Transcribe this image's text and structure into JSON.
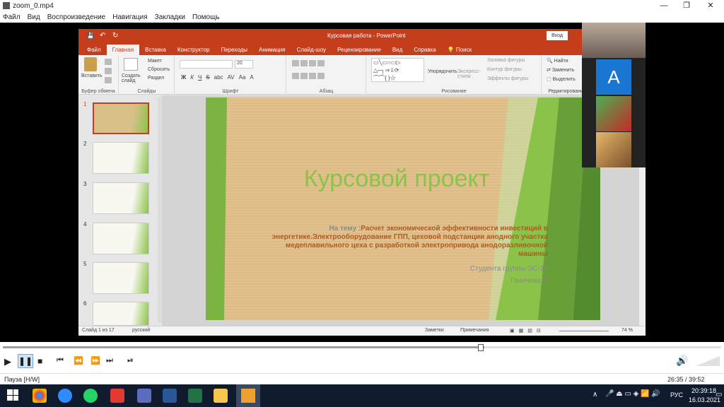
{
  "player": {
    "title": "zoom_0.mp4",
    "menu": [
      "Файл",
      "Вид",
      "Воспроизведение",
      "Навигация",
      "Закладки",
      "Помощь"
    ],
    "status": "Пауза [H/W]",
    "time": "26:35 / 39:52"
  },
  "ppt": {
    "window_title": "Курсовая работа  -  PowerPoint",
    "signin": "Вход",
    "tabs": [
      "Файл",
      "Главная",
      "Вставка",
      "Конструктор",
      "Переходы",
      "Анимация",
      "Слайд-шоу",
      "Рецензирование",
      "Вид",
      "Справка",
      "Поиск"
    ],
    "active_tab": "Главная",
    "groups": {
      "clipboard": {
        "name": "Буфер обмена",
        "paste": "Вставить"
      },
      "slides": {
        "name": "Слайды",
        "create": "Создать слайд",
        "layout": "Макет",
        "reset": "Сбросить",
        "section": "Раздел"
      },
      "font": {
        "name": "Шрифт",
        "size": "20",
        "bold": "Ж",
        "italic": "К",
        "underline": "Ч",
        "strike": "S",
        "abc": "abc",
        "av": "AV",
        "aa": "Aa",
        "a": "A"
      },
      "paragraph": {
        "name": "Абзац"
      },
      "drawing": {
        "name": "Рисование",
        "arrange": "Упорядочить",
        "express": "Экспресс-стили",
        "fill": "Заливка фигуры",
        "outline": "Контур фигуры",
        "effects": "Эффекты фигуры"
      },
      "editing": {
        "name": "Редактирование",
        "find": "Найти",
        "replace": "Заменить",
        "select": "Выделить"
      }
    },
    "slide": {
      "title": "Курсовой проект",
      "topic_prefix": "На тему :",
      "topic": "Расчет экономической эффективности инвестиций в энергетике.Электрооборудование ГПП, цеховой подстанции анодного участка медеплавильного цеха с разработкой электропривода анодоразливочной машины",
      "student": "Студента группы ЭС-17",
      "name": "Ганичева Н"
    },
    "status": {
      "slide": "Слайд 1 из 17",
      "lang": "русский",
      "notes": "Заметки",
      "comments": "Примечания",
      "zoom": "74 %"
    },
    "thumbs": [
      "1",
      "2",
      "3",
      "4",
      "5",
      "6"
    ]
  },
  "participants": [
    {
      "kind": "video"
    },
    {
      "kind": "avatar",
      "letter": "A"
    },
    {
      "kind": "image"
    },
    {
      "kind": "image"
    }
  ],
  "taskbar": {
    "lang": "РУС",
    "time": "20:39:18",
    "date": "16.03.2021"
  }
}
